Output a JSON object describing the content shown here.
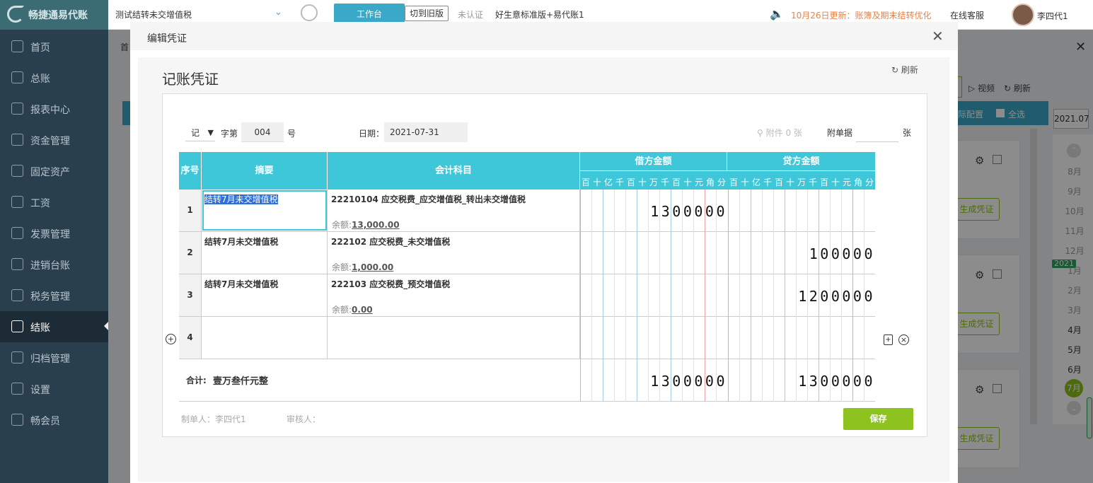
{
  "sidebar": {
    "logo": "畅捷通易代账",
    "items": [
      {
        "label": "首页",
        "icon": "home-icon"
      },
      {
        "label": "总账",
        "icon": "ledger-icon"
      },
      {
        "label": "报表中心",
        "icon": "chart-icon"
      },
      {
        "label": "资金管理",
        "icon": "money-icon"
      },
      {
        "label": "固定资产",
        "icon": "building-icon"
      },
      {
        "label": "工资",
        "icon": "salary-icon"
      },
      {
        "label": "发票管理",
        "icon": "invoice-icon"
      },
      {
        "label": "进销台账",
        "icon": "inventory-icon"
      },
      {
        "label": "税务管理",
        "icon": "tax-icon"
      },
      {
        "label": "结账",
        "icon": "checkout-icon"
      },
      {
        "label": "归档管理",
        "icon": "archive-icon"
      },
      {
        "label": "设置",
        "icon": "gear-icon"
      },
      {
        "label": "畅会员",
        "icon": "vip-icon"
      }
    ],
    "active_index": 9
  },
  "topbar": {
    "company": "测试结转未交增值税",
    "workbench": "工作台",
    "old_version": "切到旧版",
    "cert": "未认证",
    "plan": "好生意标准版+易代账1",
    "update": "10月26日更新：账簿及期末结转优化",
    "service": "在线客服",
    "user": "李四代1"
  },
  "background": {
    "tab_home": "首",
    "video": "视频",
    "refresh": "刷新",
    "config": "际配置",
    "select_all": "全选",
    "year_month": "2021.07",
    "generate": "生成凭证",
    "year_badge": "2021",
    "months": [
      "8月",
      "9月",
      "10月",
      "11月",
      "12月",
      "1月",
      "2月",
      "3月",
      "4月",
      "5月",
      "6月",
      "7月"
    ]
  },
  "modal": {
    "title": "编辑凭证",
    "voucher_title": "记账凭证",
    "refresh": "刷新",
    "voucher_type": "记",
    "zi_di": "字第",
    "voucher_no": "004",
    "hao": "号",
    "date_label": "日期：",
    "date": "2021-07-31",
    "attachment": "附件 0 张",
    "attached_docs_label": "附单据",
    "attached_docs_value": "",
    "zhang": "张",
    "columns": {
      "seq": "序号",
      "summary": "摘要",
      "account": "会计科目",
      "debit": "借方金额",
      "credit": "贷方金额"
    },
    "digit_units": [
      "百",
      "十",
      "亿",
      "千",
      "百",
      "十",
      "万",
      "千",
      "百",
      "十",
      "元",
      "角",
      "分"
    ],
    "rows": [
      {
        "seq": "1",
        "summary": "结转7月未交增值税",
        "account": "22210104 应交税费_应交增值税_转出未交增值税",
        "balance_label": "余额:",
        "balance": "13,000.00",
        "debit": "1300000",
        "credit": ""
      },
      {
        "seq": "2",
        "summary": "结转7月未交增值税",
        "account": "222102 应交税费_未交增值税",
        "balance_label": "余额:",
        "balance": "1,000.00",
        "debit": "",
        "credit": "100000"
      },
      {
        "seq": "3",
        "summary": "结转7月未交增值税",
        "account": "222103 应交税费_预交增值税",
        "balance_label": "余额:",
        "balance": "0.00",
        "debit": "",
        "credit": "1200000"
      },
      {
        "seq": "4",
        "summary": "",
        "account": "",
        "balance_label": "",
        "balance": "",
        "debit": "",
        "credit": ""
      }
    ],
    "total_label": "合计:",
    "total_text": "壹万叁仟元整",
    "total_debit": "1300000",
    "total_credit": "1300000",
    "maker": "制单人：李四代1",
    "checker": "审核人：",
    "save": "保存"
  }
}
